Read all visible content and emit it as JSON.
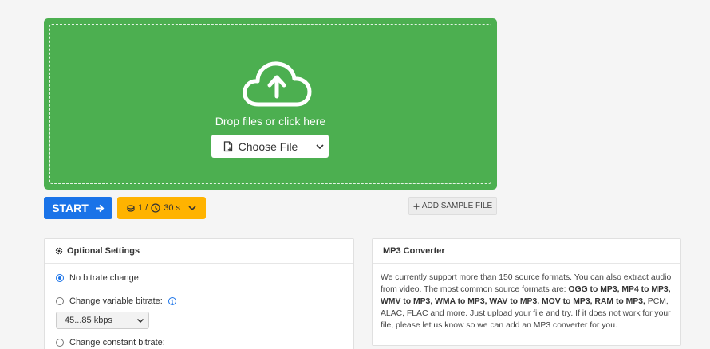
{
  "dropzone": {
    "prompt": "Drop files or click here",
    "choose_label": "Choose File",
    "bg_color": "#4caf50"
  },
  "actions": {
    "start_label": "START",
    "limits_files": "1 /",
    "limits_time": "30 s",
    "sample_label": "ADD SAMPLE FILE",
    "start_color": "#1a73e8",
    "limits_color": "#ffb300"
  },
  "settings": {
    "title": "Optional Settings",
    "options": [
      {
        "label": "No bitrate change",
        "selected": true
      },
      {
        "label": "Change variable bitrate:",
        "selected": false
      },
      {
        "label": "Change constant bitrate:",
        "selected": false
      }
    ],
    "vbr_value": "45...85 kbps"
  },
  "converter": {
    "title": "MP3 Converter",
    "text_1": "We currently support more than 150 source formats. You can also extract audio from video. The most common source formats are: ",
    "formats": "OGG to MP3, MP4 to MP3, WMV to MP3, WMA to MP3, WAV to MP3, MOV to MP3, RAM to MP3,",
    "text_2": " PCM, ALAC, FLAC and more. Just upload your file and try. If it does not work for your file, please let us know so we can add an MP3 converter for you."
  },
  "icons": [
    "cloud-upload-icon",
    "file-plus-icon",
    "chevron-down-icon",
    "arrow-right-icon",
    "coins-icon",
    "clock-icon",
    "plus-icon",
    "gear-icon",
    "info-icon"
  ]
}
